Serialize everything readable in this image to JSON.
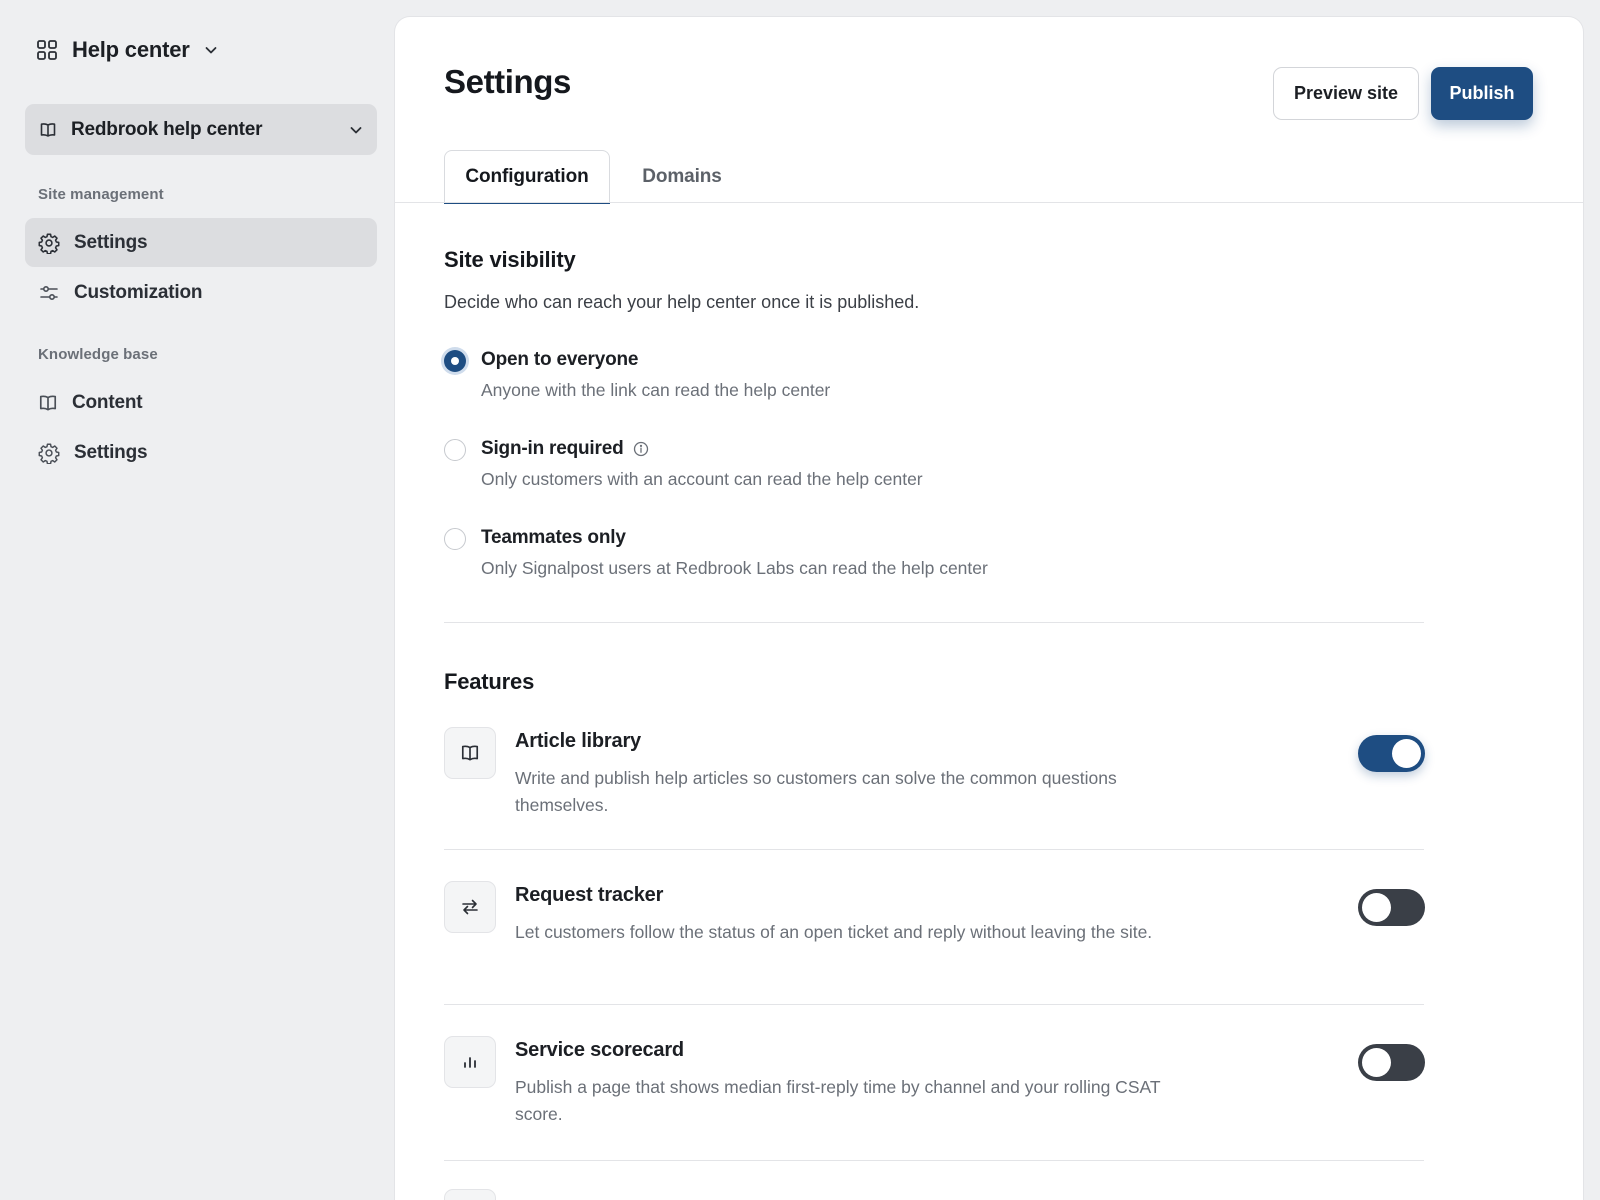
{
  "app": {
    "title": "Help center"
  },
  "site_selector": {
    "label": "Redbrook help center"
  },
  "sidebar": {
    "sections": [
      {
        "label": "Site management",
        "items": [
          {
            "label": "Settings",
            "icon": "gear-icon",
            "active": true
          },
          {
            "label": "Customization",
            "icon": "sliders-icon",
            "active": false
          }
        ]
      },
      {
        "label": "Knowledge base",
        "items": [
          {
            "label": "Content",
            "icon": "book-icon",
            "active": false
          },
          {
            "label": "Settings",
            "icon": "gear-icon",
            "active": false
          }
        ]
      }
    ]
  },
  "header": {
    "title": "Settings",
    "preview_label": "Preview site",
    "publish_label": "Publish"
  },
  "tabs": [
    {
      "label": "Configuration",
      "active": true
    },
    {
      "label": "Domains",
      "active": false
    }
  ],
  "visibility": {
    "heading": "Site visibility",
    "description": "Decide who can reach your help center once it is published.",
    "options": [
      {
        "title": "Open to everyone",
        "subtitle": "Anyone with the link can read the help center",
        "selected": true
      },
      {
        "title": "Sign-in required",
        "subtitle": "Only customers with an account can read the help center",
        "selected": false,
        "info_icon": "info-icon"
      },
      {
        "title": "Teammates only",
        "subtitle": "Only Signalpost users at Redbrook Labs can read the help center",
        "selected": false
      }
    ]
  },
  "features": {
    "heading": "Features",
    "items": [
      {
        "title": "Article library",
        "description": "Write and publish help articles so customers can solve the common questions themselves.",
        "icon": "book-icon",
        "enabled": true
      },
      {
        "title": "Request tracker",
        "description": "Let customers follow the status of an open ticket and reply without leaving the site.",
        "icon": "arrows-swap-icon",
        "enabled": false
      },
      {
        "title": "Service scorecard",
        "description": "Publish a page that shows median first-reply time by channel and your rolling CSAT score.",
        "icon": "bar-chart-icon",
        "enabled": false
      }
    ]
  },
  "colors": {
    "accent": "#1e4d82",
    "background": "#eeeff1",
    "toggle_off": "#3a3f47"
  }
}
